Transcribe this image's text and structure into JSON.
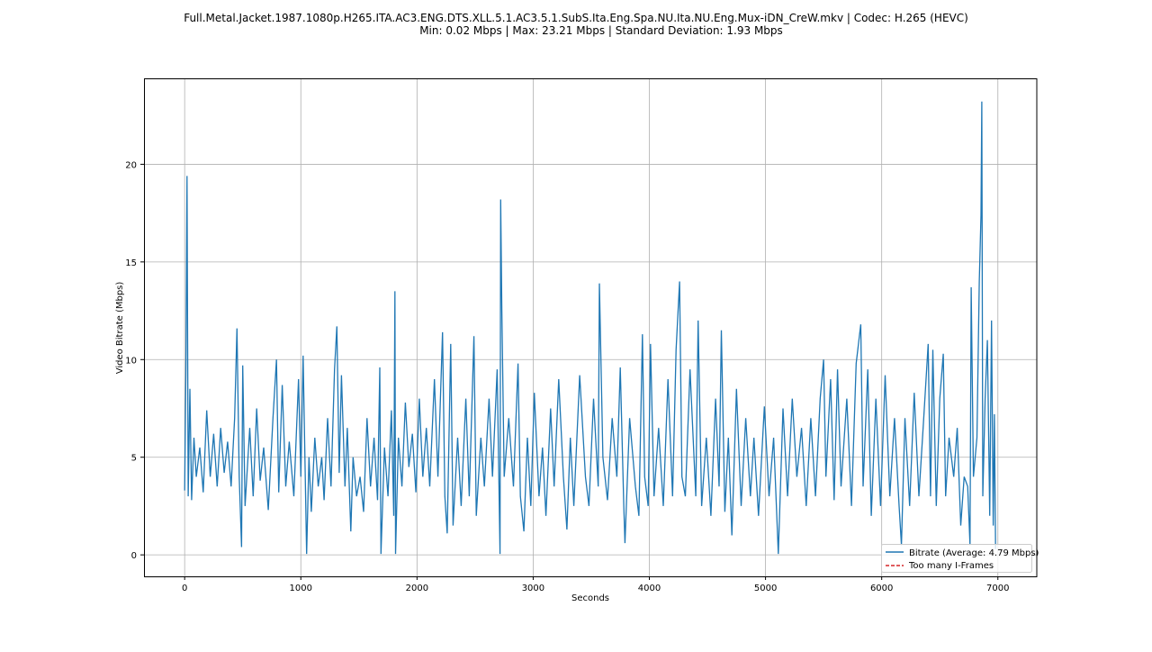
{
  "chart_data": {
    "type": "line",
    "title": "Full.Metal.Jacket.1987.1080p.H265.ITA.AC3.ENG.DTS.XLL.5.1.AC3.5.1.SubS.Ita.Eng.Spa.NU.Ita.NU.Eng.Mux-iDN_CreW.mkv | Codec: H.265 (HEVC)",
    "subtitle": "Min: 0.02 Mbps | Max: 23.21 Mbps | Standard Deviation: 1.93 Mbps",
    "xlabel": "Seconds",
    "ylabel": "Video Bitrate (Mbps)",
    "xlim": [
      -350,
      7335
    ],
    "ylim": [
      -1.1,
      24.4
    ],
    "xticks": [
      0,
      1000,
      2000,
      3000,
      4000,
      5000,
      6000,
      7000
    ],
    "yticks": [
      0,
      5,
      10,
      15,
      20
    ],
    "grid": true,
    "legend_position": "bottom-right",
    "legend": [
      "Bitrate (Average: 4.79 Mbps)",
      "Too many I-Frames"
    ],
    "colors": {
      "bitrate": "#1f77b4",
      "iframes": "#d62728"
    },
    "series": [
      {
        "name": "Bitrate (Average: 4.79 Mbps)",
        "points": [
          [
            0,
            3.3
          ],
          [
            10,
            9.2
          ],
          [
            20,
            19.4
          ],
          [
            30,
            3
          ],
          [
            45,
            8.5
          ],
          [
            60,
            2.8
          ],
          [
            80,
            6
          ],
          [
            100,
            4
          ],
          [
            130,
            5.5
          ],
          [
            160,
            3.2
          ],
          [
            190,
            7.4
          ],
          [
            220,
            4
          ],
          [
            250,
            6.2
          ],
          [
            280,
            3.5
          ],
          [
            310,
            6.5
          ],
          [
            340,
            4.2
          ],
          [
            370,
            5.8
          ],
          [
            400,
            3.5
          ],
          [
            430,
            7
          ],
          [
            450,
            11.6
          ],
          [
            470,
            4
          ],
          [
            490,
            0.4
          ],
          [
            500,
            9.7
          ],
          [
            520,
            2.5
          ],
          [
            560,
            6.5
          ],
          [
            590,
            3
          ],
          [
            620,
            7.5
          ],
          [
            650,
            3.8
          ],
          [
            680,
            5.5
          ],
          [
            720,
            2.3
          ],
          [
            760,
            7
          ],
          [
            790,
            10
          ],
          [
            810,
            3.2
          ],
          [
            840,
            8.7
          ],
          [
            870,
            3.5
          ],
          [
            900,
            5.8
          ],
          [
            940,
            3
          ],
          [
            980,
            9
          ],
          [
            1000,
            4
          ],
          [
            1020,
            10.2
          ],
          [
            1050,
            0.05
          ],
          [
            1070,
            5
          ],
          [
            1090,
            2.2
          ],
          [
            1120,
            6
          ],
          [
            1150,
            3.5
          ],
          [
            1180,
            5
          ],
          [
            1200,
            2.8
          ],
          [
            1230,
            7
          ],
          [
            1260,
            3.5
          ],
          [
            1290,
            9.5
          ],
          [
            1310,
            11.7
          ],
          [
            1330,
            4.2
          ],
          [
            1350,
            9.2
          ],
          [
            1380,
            3.5
          ],
          [
            1400,
            6.5
          ],
          [
            1430,
            1.2
          ],
          [
            1450,
            5
          ],
          [
            1480,
            3
          ],
          [
            1510,
            4
          ],
          [
            1540,
            2.2
          ],
          [
            1570,
            7
          ],
          [
            1600,
            3.5
          ],
          [
            1630,
            6
          ],
          [
            1660,
            2.8
          ],
          [
            1680,
            9.6
          ],
          [
            1690,
            0.05
          ],
          [
            1720,
            5.5
          ],
          [
            1750,
            3
          ],
          [
            1780,
            7.4
          ],
          [
            1800,
            2
          ],
          [
            1810,
            13.5
          ],
          [
            1815,
            0.05
          ],
          [
            1840,
            6
          ],
          [
            1870,
            3.5
          ],
          [
            1900,
            7.8
          ],
          [
            1930,
            4.5
          ],
          [
            1960,
            6.2
          ],
          [
            1990,
            3.2
          ],
          [
            2020,
            8
          ],
          [
            2050,
            4
          ],
          [
            2080,
            6.5
          ],
          [
            2110,
            3.5
          ],
          [
            2150,
            9
          ],
          [
            2180,
            4
          ],
          [
            2220,
            11.4
          ],
          [
            2240,
            3
          ],
          [
            2260,
            1.1
          ],
          [
            2290,
            10.8
          ],
          [
            2310,
            1.5
          ],
          [
            2350,
            6
          ],
          [
            2380,
            2.5
          ],
          [
            2420,
            8
          ],
          [
            2450,
            3
          ],
          [
            2490,
            11.2
          ],
          [
            2510,
            2
          ],
          [
            2550,
            6
          ],
          [
            2580,
            3.5
          ],
          [
            2620,
            8
          ],
          [
            2650,
            4
          ],
          [
            2690,
            9.5
          ],
          [
            2715,
            0.05
          ],
          [
            2720,
            18.2
          ],
          [
            2730,
            12.5
          ],
          [
            2750,
            4
          ],
          [
            2790,
            7
          ],
          [
            2830,
            3.5
          ],
          [
            2870,
            9.8
          ],
          [
            2890,
            3
          ],
          [
            2920,
            1.2
          ],
          [
            2950,
            6
          ],
          [
            2980,
            2.5
          ],
          [
            3010,
            8.3
          ],
          [
            3050,
            3
          ],
          [
            3080,
            5.5
          ],
          [
            3110,
            2
          ],
          [
            3150,
            7.5
          ],
          [
            3180,
            3.5
          ],
          [
            3220,
            9
          ],
          [
            3260,
            4
          ],
          [
            3290,
            1.3
          ],
          [
            3320,
            6
          ],
          [
            3350,
            2.5
          ],
          [
            3400,
            9.2
          ],
          [
            3450,
            4
          ],
          [
            3480,
            2.5
          ],
          [
            3520,
            8
          ],
          [
            3560,
            3.5
          ],
          [
            3570,
            13.9
          ],
          [
            3600,
            5
          ],
          [
            3640,
            2.8
          ],
          [
            3680,
            7
          ],
          [
            3720,
            4
          ],
          [
            3750,
            9.6
          ],
          [
            3780,
            2.5
          ],
          [
            3790,
            0.6
          ],
          [
            3830,
            7
          ],
          [
            3880,
            3.5
          ],
          [
            3910,
            2
          ],
          [
            3940,
            11.3
          ],
          [
            3960,
            4
          ],
          [
            3990,
            2.5
          ],
          [
            4010,
            10.8
          ],
          [
            4040,
            3
          ],
          [
            4080,
            6.5
          ],
          [
            4120,
            2.5
          ],
          [
            4160,
            9
          ],
          [
            4200,
            3
          ],
          [
            4230,
            10.5
          ],
          [
            4260,
            14
          ],
          [
            4280,
            4
          ],
          [
            4310,
            3
          ],
          [
            4350,
            9.5
          ],
          [
            4400,
            3
          ],
          [
            4420,
            12
          ],
          [
            4450,
            2.5
          ],
          [
            4490,
            6
          ],
          [
            4530,
            2
          ],
          [
            4570,
            8
          ],
          [
            4600,
            3.5
          ],
          [
            4620,
            11.5
          ],
          [
            4650,
            2.2
          ],
          [
            4680,
            6
          ],
          [
            4710,
            1
          ],
          [
            4750,
            8.5
          ],
          [
            4790,
            2.5
          ],
          [
            4830,
            7
          ],
          [
            4870,
            3
          ],
          [
            4900,
            6
          ],
          [
            4940,
            2
          ],
          [
            4990,
            7.6
          ],
          [
            5030,
            3
          ],
          [
            5070,
            6
          ],
          [
            5110,
            0.05
          ],
          [
            5150,
            7.5
          ],
          [
            5190,
            3
          ],
          [
            5230,
            8
          ],
          [
            5270,
            4
          ],
          [
            5310,
            6.5
          ],
          [
            5350,
            2.5
          ],
          [
            5390,
            7
          ],
          [
            5430,
            3
          ],
          [
            5470,
            8
          ],
          [
            5500,
            10
          ],
          [
            5520,
            4
          ],
          [
            5560,
            9
          ],
          [
            5590,
            2.8
          ],
          [
            5620,
            9.5
          ],
          [
            5650,
            3.5
          ],
          [
            5700,
            8
          ],
          [
            5740,
            2.5
          ],
          [
            5780,
            9.8
          ],
          [
            5820,
            11.8
          ],
          [
            5840,
            3.5
          ],
          [
            5880,
            9.5
          ],
          [
            5910,
            2
          ],
          [
            5950,
            8
          ],
          [
            5990,
            2.5
          ],
          [
            6030,
            9.2
          ],
          [
            6070,
            3
          ],
          [
            6110,
            7
          ],
          [
            6150,
            2.5
          ],
          [
            6170,
            0.5
          ],
          [
            6200,
            7
          ],
          [
            6240,
            2.5
          ],
          [
            6280,
            8.3
          ],
          [
            6320,
            3
          ],
          [
            6360,
            6.8
          ],
          [
            6400,
            10.8
          ],
          [
            6420,
            3
          ],
          [
            6440,
            10.5
          ],
          [
            6470,
            2.5
          ],
          [
            6500,
            8
          ],
          [
            6530,
            10.3
          ],
          [
            6550,
            3
          ],
          [
            6580,
            6
          ],
          [
            6620,
            4
          ],
          [
            6650,
            6.5
          ],
          [
            6680,
            1.5
          ],
          [
            6710,
            4
          ],
          [
            6740,
            3.5
          ],
          [
            6760,
            0.5
          ],
          [
            6770,
            13.7
          ],
          [
            6790,
            4
          ],
          [
            6820,
            6
          ],
          [
            6840,
            14
          ],
          [
            6855,
            17.4
          ],
          [
            6862,
            23.21
          ],
          [
            6870,
            3
          ],
          [
            6890,
            8
          ],
          [
            6910,
            11
          ],
          [
            6930,
            2
          ],
          [
            6945,
            12
          ],
          [
            6960,
            1.5
          ],
          [
            6970,
            7.2
          ],
          [
            6980,
            0.3
          ]
        ]
      }
    ]
  }
}
